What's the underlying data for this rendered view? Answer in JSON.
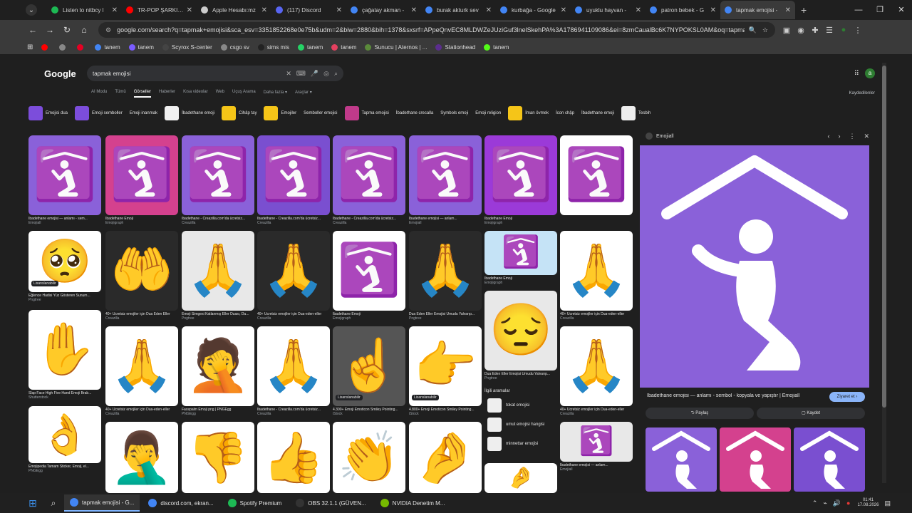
{
  "tabs": [
    {
      "label": "Listen to nitbcy l",
      "color": "#1db954"
    },
    {
      "label": "TR-POP ŞARKISIN",
      "color": "#ff0000"
    },
    {
      "label": "Apple Hesabı:mz",
      "color": "#cccccc"
    },
    {
      "label": "(117) Discord",
      "color": "#5865f2"
    },
    {
      "label": "çağatay akman -",
      "color": "#4285f4"
    },
    {
      "label": "burak akturk sev",
      "color": "#4285f4"
    },
    {
      "label": "kurbağa - Google",
      "color": "#4285f4"
    },
    {
      "label": "uyuklu hayvan -",
      "color": "#4285f4"
    },
    {
      "label": "patron bebek - G",
      "color": "#4285f4"
    },
    {
      "label": "tapmak emojisi -",
      "color": "#4285f4"
    }
  ],
  "url": "google.com/search?q=tapmak+emojisi&sca_esv=3351852268e0e75b&udm=2&biw=2880&bih=1378&sxsrf=APpeQnvEC8MLDWZeJUziGuf3lnelSkehPA%3A1786941109086&ei=8zmCaualBc6K7NYPOKSL0AM&oq=tapmak+em...",
  "bookmarks": [
    {
      "label": "",
      "color": "#ff0000"
    },
    {
      "label": "",
      "color": "#888888"
    },
    {
      "label": "",
      "color": "#e60023"
    },
    {
      "label": "tanem",
      "color": "#4285f4"
    },
    {
      "label": "tanem",
      "color": "#7a5cff"
    },
    {
      "label": "Scyrox S-center",
      "color": "#444444"
    },
    {
      "label": "csgo sv",
      "color": "#888888"
    },
    {
      "label": "sims mis",
      "color": "#222222"
    },
    {
      "label": "tanem",
      "color": "#25d366"
    },
    {
      "label": "tanem",
      "color": "#e4405f"
    },
    {
      "label": "Sunucu | Aternos | ...",
      "color": "#5a8a3a"
    },
    {
      "label": "Stationhead",
      "color": "#5b2d8e"
    },
    {
      "label": "tanem",
      "color": "#53fc18"
    }
  ],
  "search": {
    "logo": "Google",
    "query": "tapmak emojisi"
  },
  "filters": [
    "AI Modu",
    "Tümü",
    "Görseller",
    "Haberler",
    "Kısa videolar",
    "Web",
    "Uçuş Arama",
    "Daha fazla ▾",
    "Araçlar ▾"
  ],
  "filter_selected": 2,
  "saved_label": "Kaydedilenler",
  "chips": [
    {
      "label": "Emojisi dua",
      "thumb": "#7c4ddb"
    },
    {
      "label": "Emoji semboller",
      "thumb": "#7c4ddb"
    },
    {
      "label": "Emoji inanmak",
      "thumb": ""
    },
    {
      "label": "İbadethane emoji",
      "thumb": "#f0f0f0"
    },
    {
      "label": "Cihâp tay",
      "thumb": "#f5c518"
    },
    {
      "label": "Emojiler",
      "thumb": "#f5c518"
    },
    {
      "label": "Semboller emojisi",
      "thumb": ""
    },
    {
      "label": "Tapma emojisi",
      "thumb": "#c03a8a"
    },
    {
      "label": "İbadethane crecalla",
      "thumb": ""
    },
    {
      "label": "Symbols emoji",
      "thumb": ""
    },
    {
      "label": "Emoji religion",
      "thumb": ""
    },
    {
      "label": "İman övmek",
      "thumb": "#f5c518"
    },
    {
      "label": "İcon chập",
      "thumb": ""
    },
    {
      "label": "İbadethane emoji",
      "thumb": ""
    },
    {
      "label": "Tesbih",
      "thumb": "#eeeeee"
    }
  ],
  "results": [
    {
      "caption": "İbadethane emojisi — anlamı - sem...",
      "source": "Emojiall",
      "glyph": "🛐",
      "bg": "#8a61d9"
    },
    {
      "caption": "İbadethane Emoji",
      "source": "Emojigraph",
      "glyph": "🛐",
      "bg": "#d4418e"
    },
    {
      "caption": "İbadethane - Creazilla.com'da ücretsiz...",
      "source": "Creazilla",
      "glyph": "🛐",
      "bg": "#8a61d9"
    },
    {
      "caption": "İbadethane - Creazilla.com'da ücretsiz...",
      "source": "Creazilla",
      "glyph": "🛐",
      "bg": "#7a4fd0"
    },
    {
      "caption": "İbadethane - Creazilla.com'da ücretsiz...",
      "source": "Creazilla",
      "glyph": "🛐",
      "bg": "#8a61d9"
    },
    {
      "caption": "İbadethane emojisi — anlam...",
      "source": "Emojiall",
      "glyph": "🛐",
      "bg": "#8a61d9"
    },
    {
      "caption": "İbadethane Emoji",
      "source": "Emojigraph",
      "glyph": "🛐",
      "bg": "#9b3ad8"
    },
    {
      "caption": "",
      "source": "",
      "glyph": "🛐",
      "bg": "#ffffff"
    },
    {
      "caption": "Eğlence Hadisi Yüz Gösteren Sunum...",
      "source": "Pngtree",
      "glyph": "🥺",
      "bg": "#ffffff"
    },
    {
      "caption": "40+ Ücretsiz emojiler için Dua Eden Eller",
      "source": "Creazilla",
      "glyph": "🤲",
      "bg": "#2a2a2a"
    },
    {
      "caption": "Emoji Simgesi Katlanmış Eller Duası, Du...",
      "source": "Pngtree",
      "glyph": "🙏",
      "bg": "#e8e8e8"
    },
    {
      "caption": "40+ Ücretsiz emojiler için Dua-eden-eller",
      "source": "Creazilla",
      "glyph": "🙏",
      "bg": "#2a2a2a"
    },
    {
      "caption": "İbadethane Emoji",
      "source": "Emojigraph",
      "glyph": "🛐",
      "bg": "#ffffff"
    },
    {
      "caption": "Dua Eden Eller Emojisi Umudu Yalvarıp...",
      "source": "Pngtree",
      "glyph": "🙏",
      "bg": "#2a2a2a"
    },
    {
      "caption": "İbadethane Emoji",
      "source": "Emojigraph",
      "glyph": "🛐",
      "bg": "#c5e3f6"
    },
    {
      "caption": "40+ Ücretsiz emojiler için Dua-eden-eller",
      "source": "Creazilla",
      "glyph": "🙏",
      "bg": "#ffffff"
    },
    {
      "caption": "Slap Face High Five Hand Emoji Brab...",
      "source": "Shutterstock",
      "glyph": "✋",
      "bg": "#ffffff"
    },
    {
      "caption": "40+ Ücretsiz emojiler için Dua-eden-eller",
      "source": "Creazilla",
      "glyph": "🙏",
      "bg": "#ffffff"
    },
    {
      "caption": "Facepalm Emoji png | PNGEgg",
      "source": "PNGEgg",
      "glyph": "🤦",
      "bg": "#ffffff"
    },
    {
      "caption": "İbadethane - Creazilla.com'da ücretsiz...",
      "source": "Creazilla",
      "glyph": "🙏",
      "bg": "#ffffff"
    },
    {
      "caption": "4.300+ Emoji Emoticon Smiley Pointing...",
      "source": "iStock",
      "glyph": "☝️",
      "bg": "#555555"
    },
    {
      "caption": "4.800+ Emoji Emoticon Smiley Pointing...",
      "source": "iStock",
      "glyph": "👉",
      "bg": "#ffffff"
    },
    {
      "caption": "Dua Eden Eller Emojisi Umudu Yalvarıp...",
      "source": "Pngtree",
      "glyph": "😔",
      "bg": "#e8e8e8"
    },
    {
      "caption": "40+ Ücretsiz emojiler için Dua-eden-eller",
      "source": "Creazilla",
      "glyph": "🙏",
      "bg": "#ffffff"
    },
    {
      "caption": "Emojipedia Tamam Sticker, Emoji, el...",
      "source": "PNGEgg",
      "glyph": "👌",
      "bg": "#ffffff"
    },
    {
      "caption": "",
      "source": "",
      "glyph": "🤦‍♂️",
      "bg": "#ffffff"
    },
    {
      "caption": "",
      "source": "",
      "glyph": "👎",
      "bg": "#ffffff"
    },
    {
      "caption": "",
      "source": "",
      "glyph": "👍",
      "bg": "#ffffff"
    },
    {
      "caption": "",
      "source": "",
      "glyph": "👏",
      "bg": "#ffffff"
    },
    {
      "caption": "",
      "source": "",
      "glyph": "🤌",
      "bg": "#ffffff"
    },
    {
      "caption": "İbadethane emojisi — anlam...",
      "source": "Emojiall",
      "glyph": "🛐",
      "bg": "#e8e8e8"
    },
    {
      "caption": "",
      "source": "",
      "glyph": "🤌",
      "bg": "#ffffff"
    }
  ],
  "related": {
    "title": "İlgili aramalar",
    "items": [
      "tokat emojisi",
      "umut emojisi hangisi",
      "minnettar emojisi"
    ]
  },
  "badge": "Lisanslanabilir",
  "sidepanel": {
    "source": "Emojiall",
    "title": "İbadethane emojisi — anlamı - sembol - kopyala ve yapıştır | Emojiall",
    "visit": "Ziyaret et ›",
    "share": "Paylaş",
    "save": "Kaydet",
    "preview_bg": "#8a61d9",
    "related_bgs": [
      "#8a61d9",
      "#d4418e",
      "#7a4fd0"
    ]
  },
  "taskbar": [
    {
      "label": "tapmak emojisi - G...",
      "color": "#4285f4",
      "active": true
    },
    {
      "label": "discord.com, ekran...",
      "color": "#4285f4",
      "active": false
    },
    {
      "label": "Spotify Premium",
      "color": "#1db954",
      "active": false
    },
    {
      "label": "OBS 32.1.1 (GÜVEN...",
      "color": "#333333",
      "active": false
    },
    {
      "label": "NVIDIA Denetim M...",
      "color": "#76b900",
      "active": false
    }
  ],
  "clock": {
    "time": "01:41",
    "date": "17.08.2026"
  }
}
